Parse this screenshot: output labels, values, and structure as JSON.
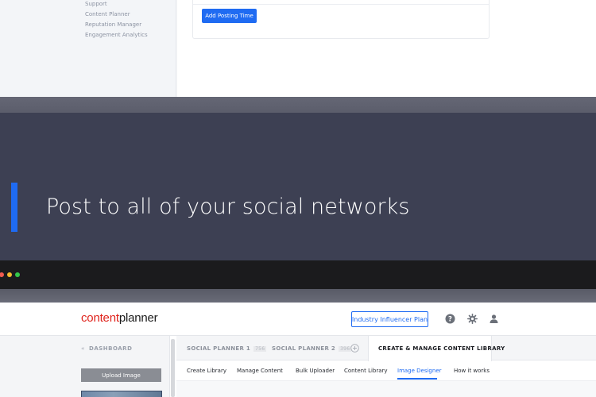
{
  "top_screenshot": {
    "sidebar_links": [
      "Support",
      "Content Planner",
      "Reputation Manager",
      "Engagement Analytics"
    ],
    "add_posting_time_label": "Add Posting Time"
  },
  "banner": {
    "title": "Post to all of your social networks",
    "accent_color": "#1f6bf2",
    "background_color": "#3d4053"
  },
  "browser": {
    "window_controls": [
      "close-dot",
      "minimize-dot",
      "maximize-dot"
    ]
  },
  "app": {
    "logo": {
      "part1": "content",
      "part2": "planner"
    },
    "header": {
      "plan_button_label": "Industry Influencer Plan",
      "icons": [
        "help-icon",
        "gear-icon",
        "user-icon"
      ]
    },
    "sidebar": {
      "dashboard_label": "DASHBOARD",
      "upload_label": "Upload Image"
    },
    "tabs": [
      {
        "label": "SOCIAL PLANNER 1",
        "count": "756"
      },
      {
        "label": "SOCIAL PLANNER 2",
        "count": "396"
      },
      {
        "label": "CREATE & MANAGE CONTENT LIBRARY"
      }
    ],
    "subnav": [
      "Create Library",
      "Manage Content",
      "Bulk Uploader",
      "Content Library",
      "Image Designer",
      "How it works"
    ],
    "active_subnav": "Image Designer"
  }
}
